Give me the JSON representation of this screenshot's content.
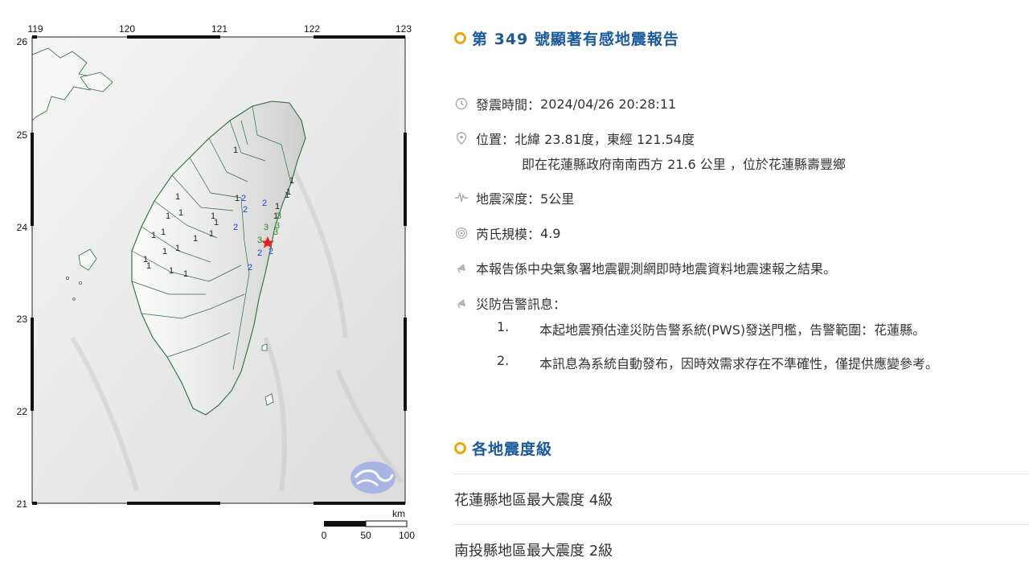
{
  "map": {
    "lon_ticks": [
      "119",
      "120",
      "121",
      "122",
      "123"
    ],
    "lat_ticks": [
      "26",
      "25",
      "24",
      "23",
      "22",
      "21"
    ],
    "scale": {
      "unit": "km",
      "labels": [
        "0",
        "50",
        "100"
      ]
    },
    "intensity_labels": [
      {
        "v": "1",
        "c": "#222"
      },
      {
        "v": "1",
        "c": "#222"
      },
      {
        "v": "1",
        "c": "#222"
      },
      {
        "v": "1",
        "c": "#222"
      },
      {
        "v": "1",
        "c": "#222"
      },
      {
        "v": "1",
        "c": "#222"
      },
      {
        "v": "1",
        "c": "#222"
      },
      {
        "v": "1",
        "c": "#222"
      },
      {
        "v": "1",
        "c": "#222"
      },
      {
        "v": "1",
        "c": "#222"
      },
      {
        "v": "1",
        "c": "#222"
      },
      {
        "v": "1",
        "c": "#222"
      },
      {
        "v": "1",
        "c": "#222"
      },
      {
        "v": "1",
        "c": "#222"
      },
      {
        "v": "1",
        "c": "#222"
      },
      {
        "v": "1",
        "c": "#222"
      },
      {
        "v": "1",
        "c": "#222"
      },
      {
        "v": "1",
        "c": "#222"
      },
      {
        "v": "1",
        "c": "#222"
      },
      {
        "v": "1",
        "c": "#222"
      },
      {
        "v": "1",
        "c": "#222"
      },
      {
        "v": "1",
        "c": "#222"
      },
      {
        "v": "2",
        "c": "#1f3fd1"
      },
      {
        "v": "2",
        "c": "#1f3fd1"
      },
      {
        "v": "2",
        "c": "#1f3fd1"
      },
      {
        "v": "2",
        "c": "#1f3fd1"
      },
      {
        "v": "2",
        "c": "#1f3fd1"
      },
      {
        "v": "2",
        "c": "#1f3fd1"
      },
      {
        "v": "2",
        "c": "#1f3fd1"
      },
      {
        "v": "3",
        "c": "#2a8c24"
      },
      {
        "v": "3",
        "c": "#2a8c24"
      },
      {
        "v": "3",
        "c": "#2a8c24"
      },
      {
        "v": "3",
        "c": "#2a8c24"
      },
      {
        "v": "3",
        "c": "#2a8c24"
      }
    ],
    "epicenter_color": "#e02020"
  },
  "report": {
    "title": "第 349 號顯著有感地震報告",
    "time_label": "發震時間：",
    "time_value": "2024/04/26 20:28:11",
    "location_label": "位置：",
    "location_value": "北緯 23.81度，東經 121.54度",
    "location_detail": "即在花蓮縣政府南南西方 21.6 公里 ，位於花蓮縣壽豐鄉",
    "depth_label": "地震深度：",
    "depth_value": "5公里",
    "magnitude_label": "芮氏規模：",
    "magnitude_value": "4.9",
    "source_note": "本報告係中央氣象署地震觀測網即時地震資料地震速報之結果。",
    "warning_title": "災防告警訊息：",
    "warnings": [
      {
        "num": "1.",
        "text": "本起地震預估達災防告警系統(PWS)發送門檻，告警範圍：花蓮縣。"
      },
      {
        "num": "2.",
        "text": "本訊息為系統自動發布，因時效需求存在不準確性，僅提供應變參考。"
      }
    ]
  },
  "regions": {
    "title": "各地震度級",
    "items": [
      "花蓮縣地區最大震度 4級",
      "南投縣地區最大震度 2級"
    ]
  },
  "colors": {
    "title_blue": "#1a5a9c",
    "ring_orange": "#f0a30a"
  }
}
